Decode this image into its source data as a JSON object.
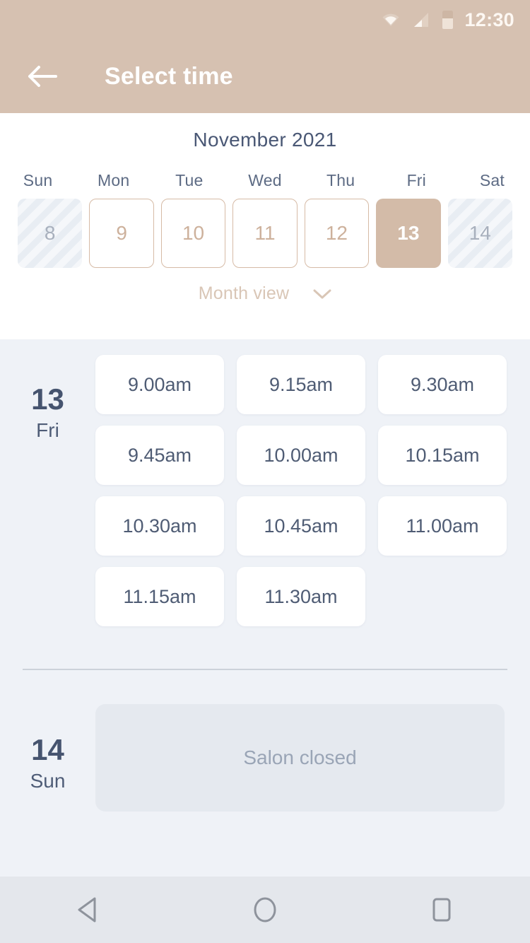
{
  "status_bar": {
    "time": "12:30",
    "icons": [
      "wifi-icon",
      "signal-icon",
      "battery-icon"
    ]
  },
  "app_bar": {
    "back_icon": "arrow-left-icon",
    "title": "Select time"
  },
  "calendar": {
    "month_title": "November 2021",
    "day_headers": [
      "Sun",
      "Mon",
      "Tue",
      "Wed",
      "Thu",
      "Fri",
      "Sat"
    ],
    "days": [
      {
        "number": "8",
        "state": "disabled"
      },
      {
        "number": "9",
        "state": "available"
      },
      {
        "number": "10",
        "state": "available"
      },
      {
        "number": "11",
        "state": "available"
      },
      {
        "number": "12",
        "state": "available"
      },
      {
        "number": "13",
        "state": "selected"
      },
      {
        "number": "14",
        "state": "disabled"
      }
    ],
    "month_view_label": "Month view",
    "month_view_icon": "chevron-down-icon"
  },
  "schedule": {
    "open_day": {
      "day_number": "13",
      "day_name": "Fri",
      "slots": [
        "9.00am",
        "9.15am",
        "9.30am",
        "9.45am",
        "10.00am",
        "10.15am",
        "10.30am",
        "10.45am",
        "11.00am",
        "11.15am",
        "11.30am"
      ]
    },
    "closed_day": {
      "day_number": "14",
      "day_name": "Sun",
      "message": "Salon closed"
    }
  },
  "nav_bar": {
    "back": "back-triangle-icon",
    "home": "home-circle-icon",
    "recents": "recents-square-icon"
  },
  "colors": {
    "header_bg": "#d6c1b1",
    "accent_tan": "#d3bba8",
    "page_bg": "#eff2f7",
    "text_slate": "#4a5875",
    "closed_bg": "#e5e9ef"
  }
}
